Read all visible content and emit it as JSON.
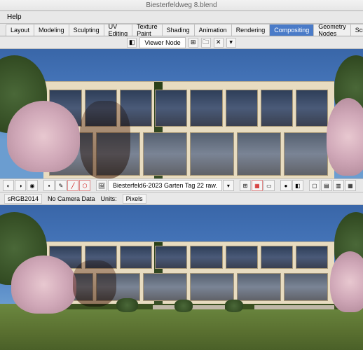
{
  "title_bar": "Biesterfeldweg 8.blend",
  "menu": {
    "help": "Help"
  },
  "workspace_tabs": [
    "Layout",
    "Modeling",
    "Sculpting",
    "UV Editing",
    "Texture Paint",
    "Shading",
    "Animation",
    "Rendering",
    "Compositing",
    "Geometry Nodes",
    "Scripting"
  ],
  "active_tab_index": 8,
  "header": {
    "viewer_node": "Viewer Node",
    "node_icon": "◧",
    "dropdown_icon": "▾",
    "folder_icon": "🗀",
    "close_icon": "✕"
  },
  "mid_toolbar": {
    "filename": "Biesterfeld6-2023 Garten Tag 22 raw.",
    "dropdown_icon": "▾"
  },
  "status": {
    "color_space": "sRGB2014",
    "camera": "No Camera Data",
    "units_label": "Units:",
    "units_value": "Pixels"
  }
}
